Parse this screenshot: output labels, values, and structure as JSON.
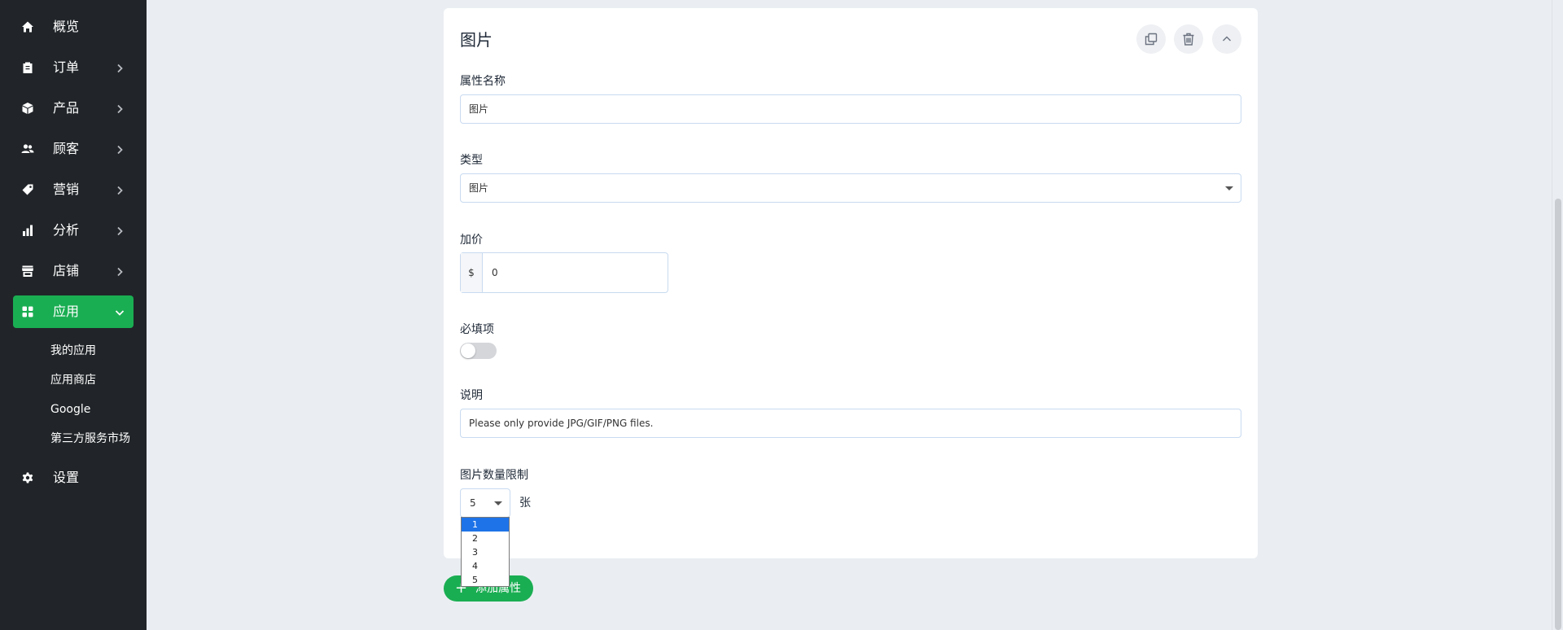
{
  "sidebar": {
    "items": [
      {
        "label": "概览",
        "icon": "home-icon"
      },
      {
        "label": "订单",
        "icon": "clipboard-icon"
      },
      {
        "label": "产品",
        "icon": "box-icon"
      },
      {
        "label": "顾客",
        "icon": "users-icon"
      },
      {
        "label": "营销",
        "icon": "tag-icon"
      },
      {
        "label": "分析",
        "icon": "bar-chart-icon"
      },
      {
        "label": "店铺",
        "icon": "store-icon"
      },
      {
        "label": "应用",
        "icon": "apps-icon",
        "active": true
      },
      {
        "label": "设置",
        "icon": "gear-icon"
      }
    ],
    "apps_submenu": [
      "我的应用",
      "应用商店",
      "Google",
      "第三方服务市场"
    ]
  },
  "card": {
    "title": "图片",
    "actions": [
      "copy-icon",
      "trash-icon",
      "chevron-up-icon"
    ],
    "attribute_name": {
      "label": "属性名称",
      "value": "图片"
    },
    "type": {
      "label": "类型",
      "value": "图片"
    },
    "price": {
      "label": "加价",
      "prefix": "$",
      "value": "0"
    },
    "required": {
      "label": "必填项",
      "on": false
    },
    "description": {
      "label": "说明",
      "value": "Please only provide JPG/GIF/PNG files."
    },
    "image_limit": {
      "label": "图片数量限制",
      "value": "5",
      "unit": "张",
      "options": [
        "1",
        "2",
        "3",
        "4",
        "5"
      ],
      "highlighted": "1"
    }
  },
  "add_attribute_button": "添加属性",
  "colors": {
    "sidebar_bg": "#212529",
    "accent": "#1aae52",
    "page_bg": "#eaeef2",
    "highlight": "#1e73e8"
  }
}
